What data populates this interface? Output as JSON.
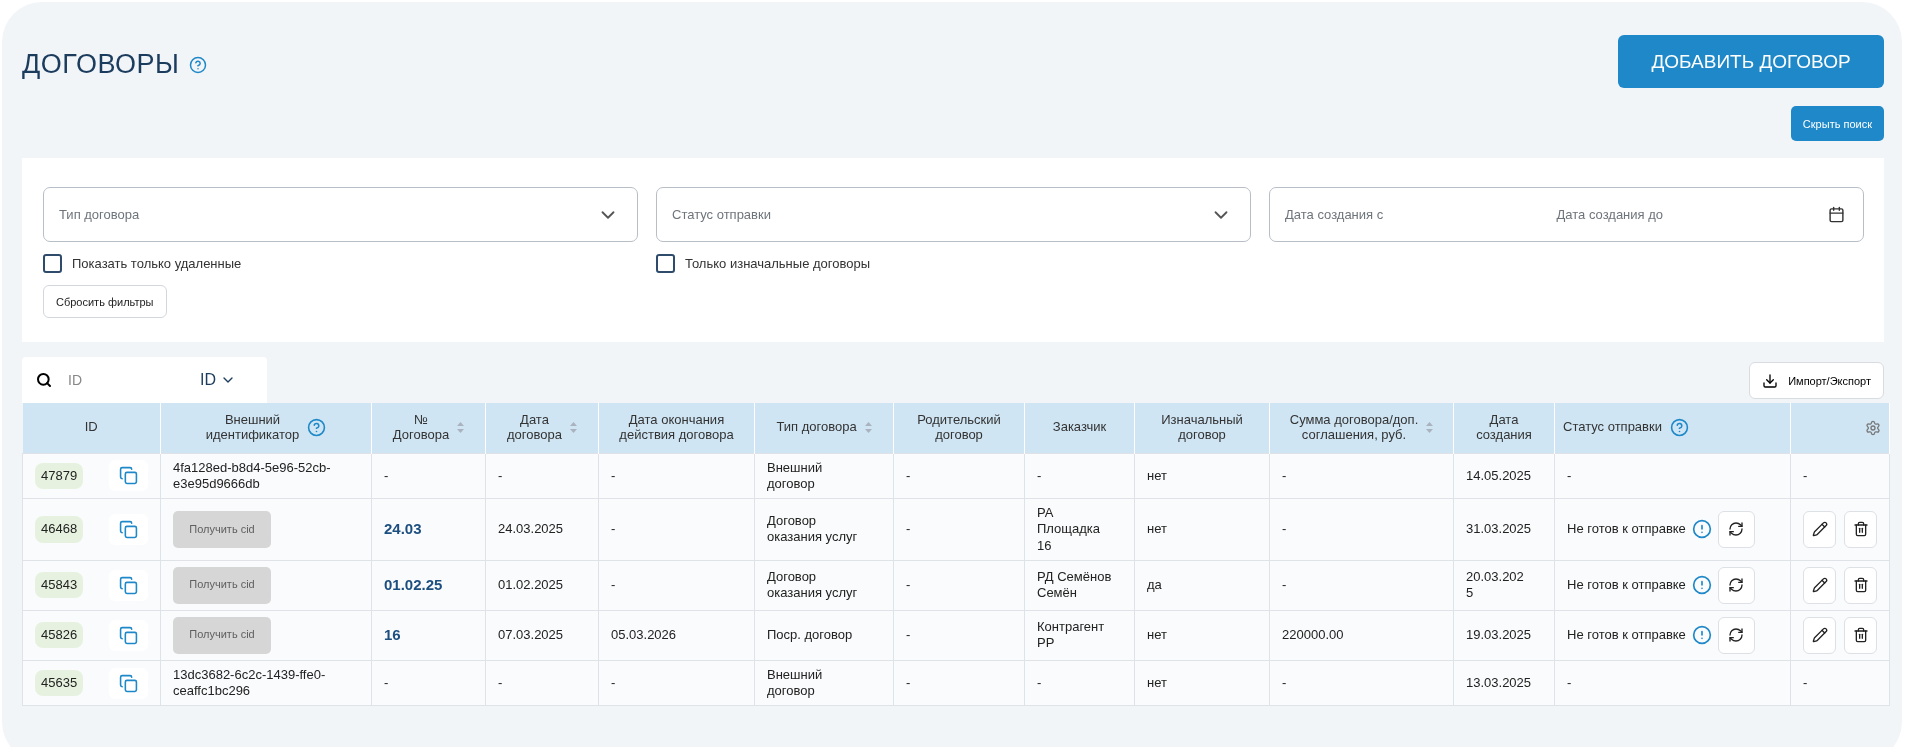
{
  "title": "ДОГОВОРЫ",
  "add_button": "ДОБАВИТЬ ДОГОВОР",
  "hide_search_button": "Скрыть поиск",
  "filters": {
    "selects": [
      {
        "placeholder": "Тип договора"
      },
      {
        "placeholder": "Статус отправки"
      }
    ],
    "date_range": {
      "from_placeholder": "Дата создания с",
      "to_placeholder": "Дата создания до"
    },
    "checkboxes": [
      {
        "label": "Показать только удаленные",
        "checked": false
      },
      {
        "label": "Только изначальные договоры",
        "checked": false
      }
    ],
    "reset_button": "Сбросить фильтры"
  },
  "search": {
    "placeholder": "ID",
    "field_selector": "ID"
  },
  "import_export_button": "Импорт/Экспорт",
  "table": {
    "columns": [
      {
        "label": "ID",
        "sortable": false,
        "help": false
      },
      {
        "label": "Внешний\nидентификатор",
        "sortable": false,
        "help": true
      },
      {
        "label": "№\nДоговора",
        "sortable": true,
        "help": false
      },
      {
        "label": "Дата\nдоговора",
        "sortable": true,
        "help": false
      },
      {
        "label": "Дата окончания\nдействия договора",
        "sortable": false,
        "help": false
      },
      {
        "label": "Тип договора",
        "sortable": true,
        "help": false
      },
      {
        "label": "Родительский\nдоговор",
        "sortable": false,
        "help": false
      },
      {
        "label": "Заказчик",
        "sortable": false,
        "help": false
      },
      {
        "label": "Изначальный\nдоговор",
        "sortable": false,
        "help": false
      },
      {
        "label": "Сумма договора/доп.\nсоглашения, руб.",
        "sortable": true,
        "help": false
      },
      {
        "label": "Дата\nсоздания",
        "sortable": false,
        "help": false
      },
      {
        "label": "Статус отправки",
        "sortable": false,
        "help": true
      },
      {
        "kind": "settings"
      }
    ],
    "rows": [
      {
        "id": "47879",
        "external": {
          "kind": "text",
          "text": "4fa128ed-b8d4-5e96-52cb-\ne3e95d9666db"
        },
        "number": {
          "text": "-",
          "link": false
        },
        "date": "-",
        "end_date": "-",
        "type": "Внешний\nдоговор",
        "parent": "-",
        "customer": "-",
        "original": "нет",
        "sum": "-",
        "created": "14.05.2025",
        "status": {
          "kind": "plain",
          "text": "-"
        },
        "actions": {
          "kind": "text",
          "text": "-"
        }
      },
      {
        "id": "46468",
        "external": {
          "kind": "button",
          "text": "Получить cid"
        },
        "number": {
          "text": "24.03",
          "link": true
        },
        "date": "24.03.2025",
        "end_date": "-",
        "type": "Договор\nоказания услуг",
        "parent": "-",
        "customer": "РА\nПлощадка\n16",
        "original": "нет",
        "sum": "-",
        "created": "31.03.2025",
        "status": {
          "kind": "warning",
          "text": "Не готов к отправке"
        },
        "actions": {
          "kind": "buttons"
        }
      },
      {
        "id": "45843",
        "external": {
          "kind": "button",
          "text": "Получить cid"
        },
        "number": {
          "text": "01.02.25",
          "link": true
        },
        "date": "01.02.2025",
        "end_date": "-",
        "type": "Договор\nоказания услуг",
        "parent": "-",
        "customer": "РД Семёнов\nСемён",
        "original": "да",
        "sum": "-",
        "created": "20.03.202\n5",
        "status": {
          "kind": "warning",
          "text": "Не готов к отправке"
        },
        "actions": {
          "kind": "buttons"
        }
      },
      {
        "id": "45826",
        "external": {
          "kind": "button",
          "text": "Получить cid"
        },
        "number": {
          "text": "16",
          "link": true
        },
        "date": "07.03.2025",
        "end_date": "05.03.2026",
        "type": "Поср. договор",
        "parent": "-",
        "customer": "Контрагент\nРР",
        "original": "нет",
        "sum": "220000.00",
        "created": "19.03.2025",
        "status": {
          "kind": "warning",
          "text": "Не готов к отправке"
        },
        "actions": {
          "kind": "buttons"
        }
      },
      {
        "id": "45635",
        "external": {
          "kind": "text",
          "text": "13dc3682-6c2c-1439-ffe0-\nceaffc1bc296"
        },
        "number": {
          "text": "-",
          "link": false
        },
        "date": "-",
        "end_date": "-",
        "type": "Внешний\nдоговор",
        "parent": "-",
        "customer": "-",
        "original": "нет",
        "sum": "-",
        "created": "13.03.2025",
        "status": {
          "kind": "plain",
          "text": "-"
        },
        "actions": {
          "kind": "text",
          "text": "-"
        }
      }
    ]
  }
}
